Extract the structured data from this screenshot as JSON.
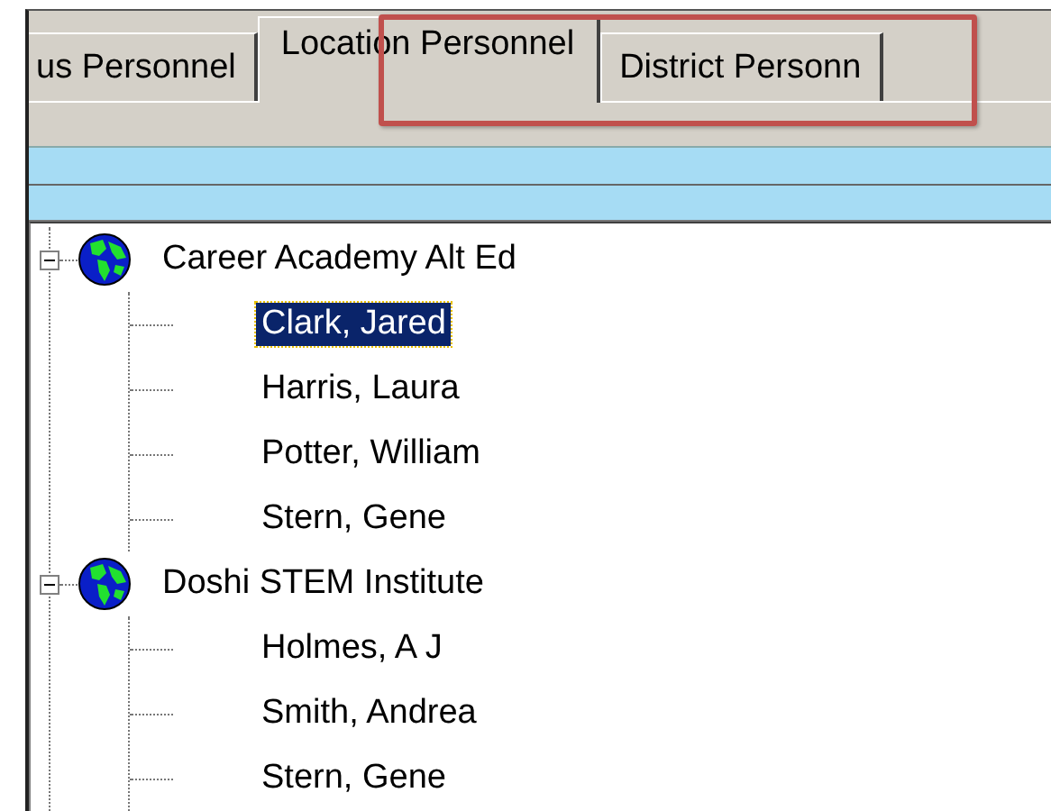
{
  "tabs": [
    {
      "label": "us Personnel",
      "selected": false
    },
    {
      "label": "Location Personnel",
      "selected": true
    },
    {
      "label": "District Personn",
      "selected": false
    }
  ],
  "highlight_box": true,
  "tree": [
    {
      "label": "Career Academy Alt Ed",
      "expanded": true,
      "children": [
        {
          "label": "Clark, Jared",
          "selected": true
        },
        {
          "label": "Harris, Laura",
          "selected": false
        },
        {
          "label": "Potter, William",
          "selected": false
        },
        {
          "label": "Stern, Gene",
          "selected": false
        }
      ]
    },
    {
      "label": "Doshi STEM Institute",
      "expanded": true,
      "children": [
        {
          "label": "Holmes, A J",
          "selected": false
        },
        {
          "label": "Smith, Andrea",
          "selected": false
        },
        {
          "label": "Stern, Gene",
          "selected": false
        }
      ]
    }
  ]
}
